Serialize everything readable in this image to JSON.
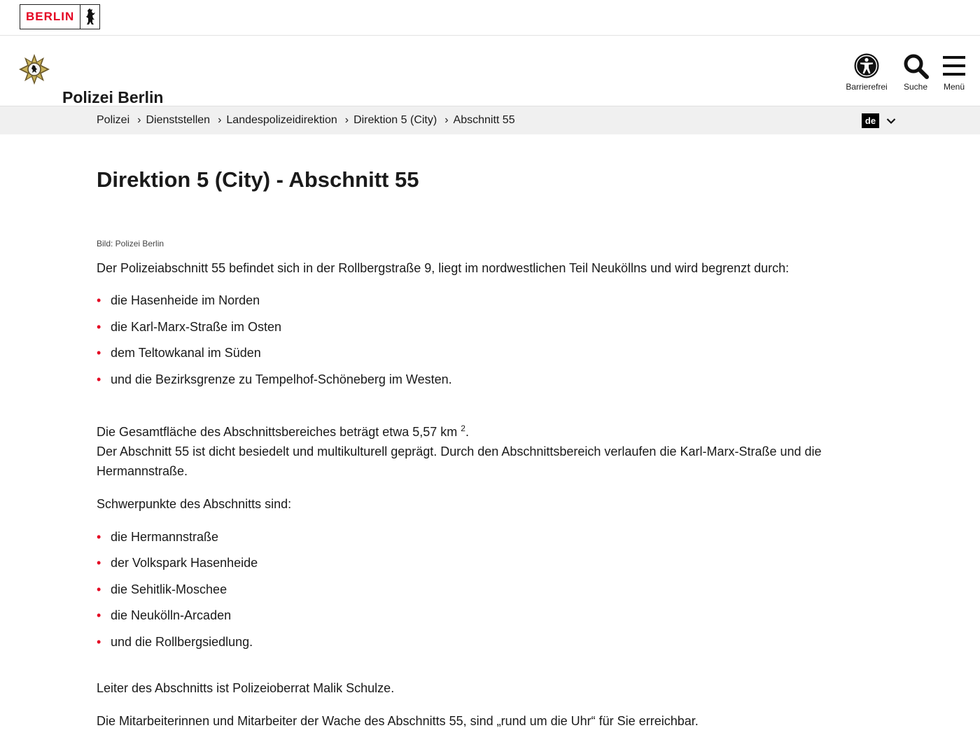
{
  "topbar": {
    "logo_text": "BERLIN"
  },
  "header": {
    "site_title": "Polizei Berlin",
    "tools": {
      "accessibility": "Barrierefrei",
      "search": "Suche",
      "menu": "Menü"
    }
  },
  "breadcrumb": {
    "items": [
      "Polizei",
      "Dienststellen",
      "Landespolizeidirektion",
      "Direktion 5 (City)",
      "Abschnitt 55"
    ],
    "language": "de"
  },
  "main": {
    "title": "Direktion 5 (City) - Abschnitt 55",
    "image_credit": "Bild: Polizei Berlin",
    "intro": "Der Polizeiabschnitt 55 befindet sich in der Rollbergstraße 9, liegt im nordwestlichen Teil Neuköllns und wird begrenzt durch:",
    "borders": [
      "die Hasenheide im Norden",
      "die Karl-Marx-Straße im Osten",
      "dem Teltowkanal im Süden",
      "und die Bezirksgrenze zu Tempelhof-Schöneberg im Westen."
    ],
    "area_text": "Die Gesamtfläche des Abschnittsbereiches beträgt etwa 5,57 km ",
    "area_sup": "2",
    "area_end": ".",
    "description": "Der Abschnitt 55 ist dicht besiedelt und multikulturell geprägt. Durch den Abschnittsbereich verlaufen die Karl-Marx-Straße und die Hermannstraße.",
    "focus_intro": "Schwerpunkte des Abschnitts sind:",
    "focus": [
      "die Hermannstraße",
      "der Volkspark Hasenheide",
      "die Sehitlik-Moschee",
      "die Neukölln-Arcaden",
      "und die Rollbergsiedlung."
    ],
    "leader": "Leiter des Abschnitts ist Polizeioberrat Malik Schulze.",
    "availability": "Die Mitarbeiterinnen und Mitarbeiter der Wache des Abschnitts 55, sind „rund um die Uhr“ für Sie erreichbar."
  },
  "colors": {
    "accent": "#e40422",
    "breadcrumb_bg": "#f0f0f0"
  }
}
